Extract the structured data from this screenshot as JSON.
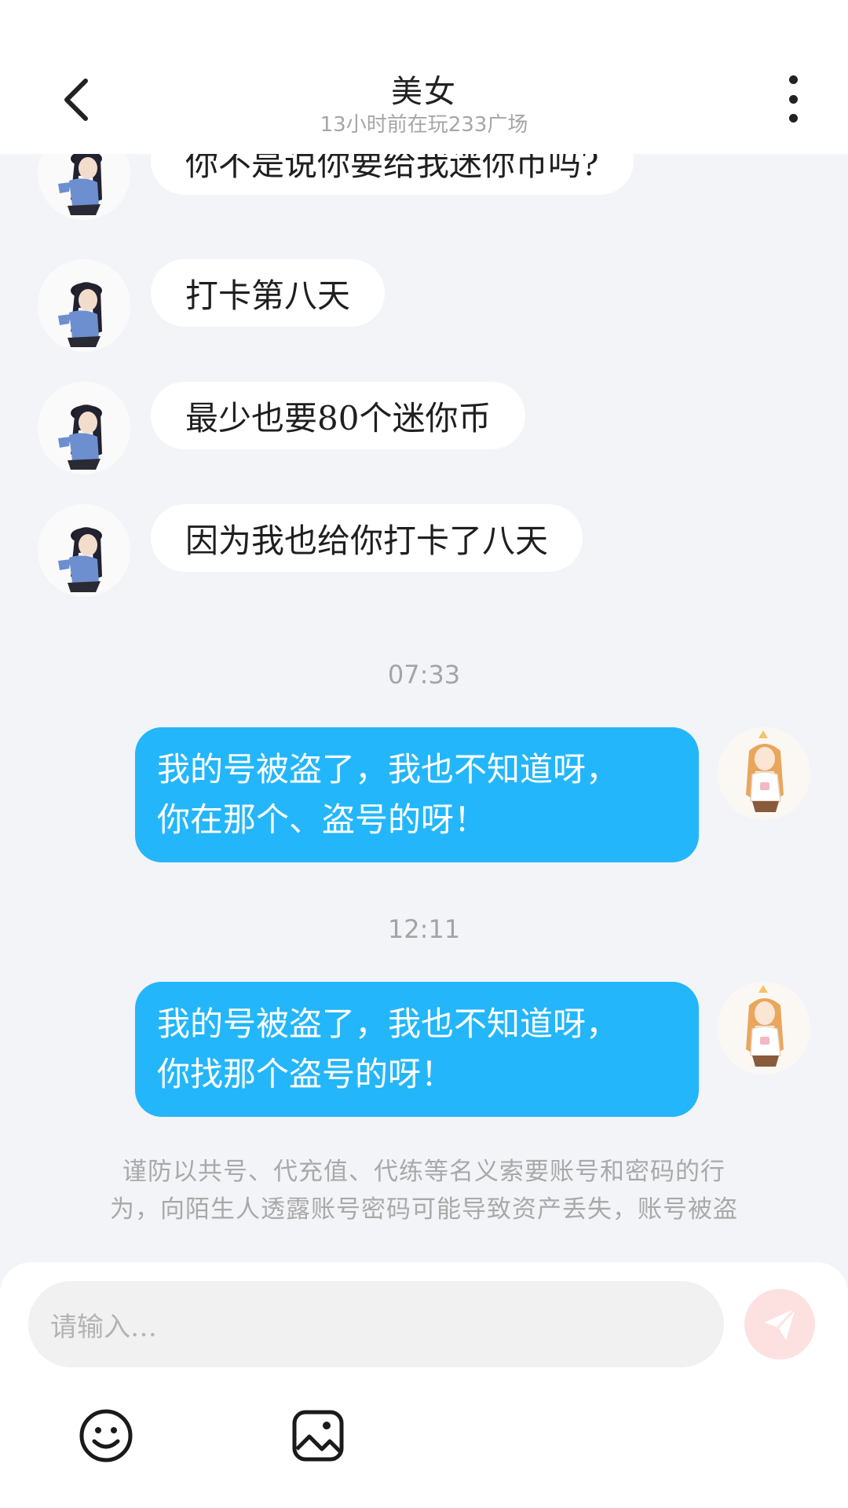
{
  "header": {
    "title": "美女",
    "subtitle": "13小时前在玩233广场"
  },
  "messages_received": [
    {
      "text": "你不是说你要给我迷你币吗?"
    },
    {
      "text": "打卡第八天"
    },
    {
      "text": "最少也要80个迷你币"
    },
    {
      "text": "因为我也给你打卡了八天"
    }
  ],
  "sent": [
    {
      "time": "07:33",
      "line1": "我的号被盗了，我也不知道呀，",
      "line2": "你在那个、盗号的呀！"
    },
    {
      "time": "12:11",
      "line1": "我的号被盗了，我也不知道呀，",
      "line2": "你找那个盗号的呀！"
    }
  ],
  "notice": {
    "line1": "谨防以共号、代充值、代练等名义索要账号和密码的行",
    "line2": "为，向陌生人透露账号密码可能导致资产丢失，账号被盗"
  },
  "input": {
    "placeholder": "请输入…"
  },
  "icons": {
    "back": "chevron-left-icon",
    "more": "more-vertical-icon",
    "send": "send-icon",
    "emoji": "smiley-icon",
    "image": "image-icon"
  },
  "colors": {
    "sent_bubble": "#24b6fa",
    "received_bubble": "#ffffff",
    "background": "#f3f4f7",
    "send_button": "#fde1e1"
  }
}
